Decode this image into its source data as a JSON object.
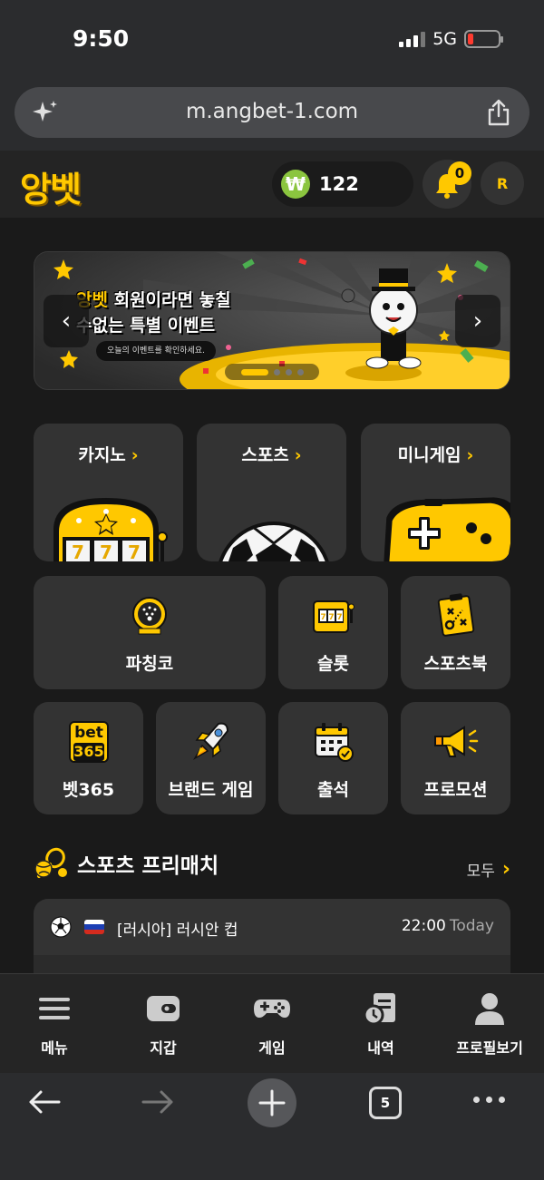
{
  "status_bar": {
    "time": "9:50",
    "network": "5G"
  },
  "browser": {
    "url": "m.angbet-1.com",
    "tab_count": "5"
  },
  "header": {
    "logo": "앙벳",
    "balance": "122",
    "currency_symbol": "₩",
    "notifications": "0",
    "avatar_initial": "R"
  },
  "banner": {
    "line1_highlight": "앙벳",
    "line1": " 회원이라면 놓칠",
    "line2": "수없는 특별 이벤트",
    "sub": "오늘의 이벤트를 확인하세요.",
    "slides": 4,
    "active_slide": 1
  },
  "categories": [
    {
      "label": "카지노",
      "icon": "slot-machine-icon"
    },
    {
      "label": "스포츠",
      "icon": "soccer-ball-icon"
    },
    {
      "label": "미니게임",
      "icon": "gamepad-icon"
    }
  ],
  "tiles_row1": [
    {
      "label": "파칭코",
      "icon": "pachinko-icon"
    },
    {
      "label": "슬롯",
      "icon": "slot-icon"
    },
    {
      "label": "스포츠북",
      "icon": "sportsbook-icon"
    }
  ],
  "tiles_row2": [
    {
      "label": "벳365",
      "icon": "bet365-icon",
      "logo_top": "bet",
      "logo_bottom": "365"
    },
    {
      "label": "브랜드 게임",
      "icon": "rocket-icon"
    },
    {
      "label": "출석",
      "icon": "calendar-check-icon"
    },
    {
      "label": "프로모션",
      "icon": "megaphone-icon"
    }
  ],
  "section": {
    "title": "스포츠 프리매치",
    "all_label": "모두"
  },
  "matches": [
    {
      "league": "[러시아] 러시안 컵",
      "time": "22:00",
      "day": "Today"
    }
  ],
  "bottom_nav": [
    {
      "label": "메뉴",
      "icon": "menu-icon"
    },
    {
      "label": "지갑",
      "icon": "wallet-icon"
    },
    {
      "label": "게임",
      "icon": "gamepad-icon"
    },
    {
      "label": "내역",
      "icon": "history-icon"
    },
    {
      "label": "프로필보기",
      "icon": "profile-icon"
    }
  ],
  "colors": {
    "accent": "#ffc800",
    "background": "#1a1a1a",
    "card": "#333333",
    "won_badge": "#8bc53f"
  }
}
